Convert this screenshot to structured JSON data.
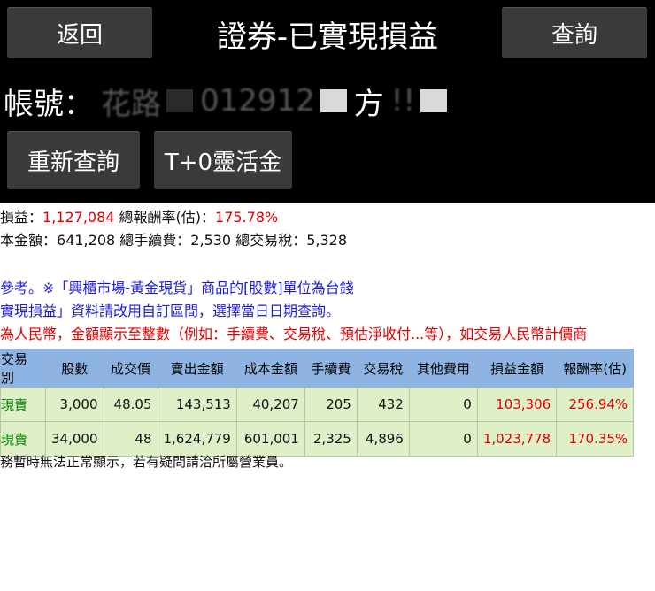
{
  "header": {
    "back_label": "返回",
    "title": "證券-已實現損益",
    "query_label": "查詢"
  },
  "account": {
    "label": "帳號：",
    "fragment_1": "花路",
    "fragment_2": "012912",
    "fragment_3": "方",
    "fragment_4": "!!"
  },
  "actions": {
    "requery_label": "重新查詢",
    "t0_label": "T+0靈活金"
  },
  "summary": {
    "pl_label": "損益：",
    "pl_value": "1,127,084",
    "return_label": "總報酬率(估)：",
    "return_value": "175.78%",
    "cost_label": "本金額：",
    "cost_value": "641,208",
    "fee_label": "總手續費：",
    "fee_value": "2,530",
    "tax_label": "總交易稅：",
    "tax_value": "5,328"
  },
  "notes": {
    "line1": "參考。※「興櫃市場-黃金現貨」商品的[股數]單位為台錢",
    "line2": "實現損益」資料請改用自訂區間，選擇當日日期查詢。",
    "line3": "為人民幣，金額顯示至整數（例如：手續費、交易稅、預估淨收付...等），如交易人民幣計價商"
  },
  "table": {
    "headers": [
      "交易別",
      "股數",
      "成交價",
      "賣出金額",
      "成本金額",
      "手續費",
      "交易稅",
      "其他費用",
      "損益金額",
      "報酬率(估)"
    ],
    "rows": [
      [
        "現賣",
        "3,000",
        "48.05",
        "143,513",
        "40,207",
        "205",
        "432",
        "0",
        "103,306",
        "256.94%"
      ],
      [
        "現賣",
        "34,000",
        "48",
        "1,624,779",
        "601,001",
        "2,325",
        "4,896",
        "0",
        "1,023,778",
        "170.35%"
      ]
    ]
  },
  "footer": {
    "text": "務暫時無法正常顯示，若有疑問請洽所屬營業員。"
  },
  "colors": {
    "header_bg": "#000000",
    "button_bg": "#3a3a3a",
    "table_header_bg": "#8db4e2",
    "table_row_bg": "#dff0c8",
    "profit": "#e00000",
    "trade_type": "#008000",
    "note_blue": "#1a1ad6"
  }
}
